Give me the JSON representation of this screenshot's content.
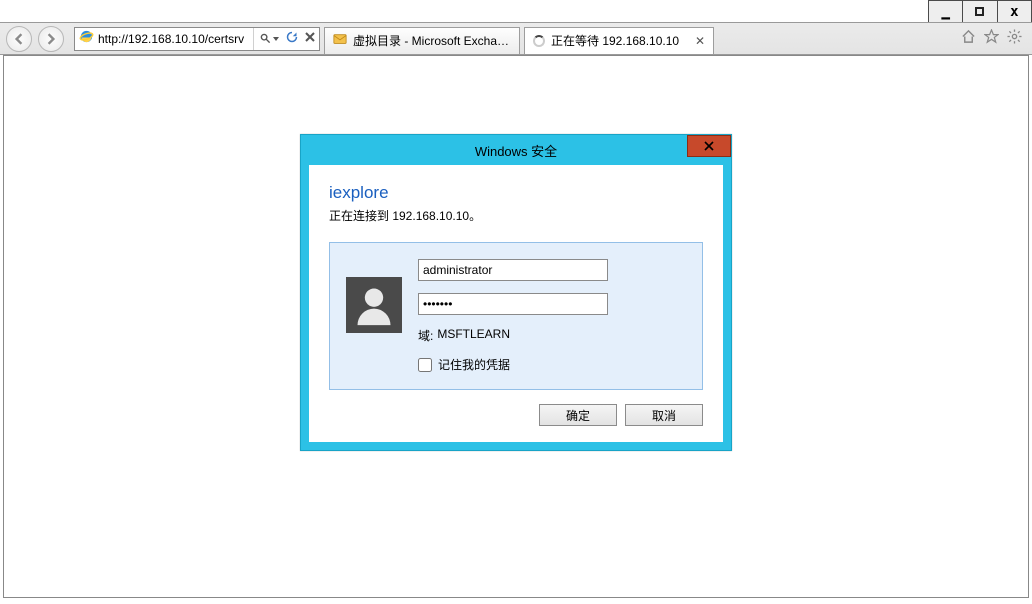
{
  "titlebar": {
    "min": "_",
    "close": "x"
  },
  "address": {
    "url": "http://192.168.10.10/certsrv"
  },
  "tabs": [
    {
      "label": "虚拟目录 - Microsoft Exchan..."
    },
    {
      "label": "正在等待 192.168.10.10"
    }
  ],
  "dialog": {
    "title": "Windows 安全",
    "app": "iexplore",
    "connecting": "正在连接到 192.168.10.10。",
    "username": "administrator",
    "password": "•••••••",
    "domain_label": "域:",
    "domain_value": "MSFTLEARN",
    "remember": "记住我的凭据",
    "ok": "确定",
    "cancel": "取消"
  }
}
